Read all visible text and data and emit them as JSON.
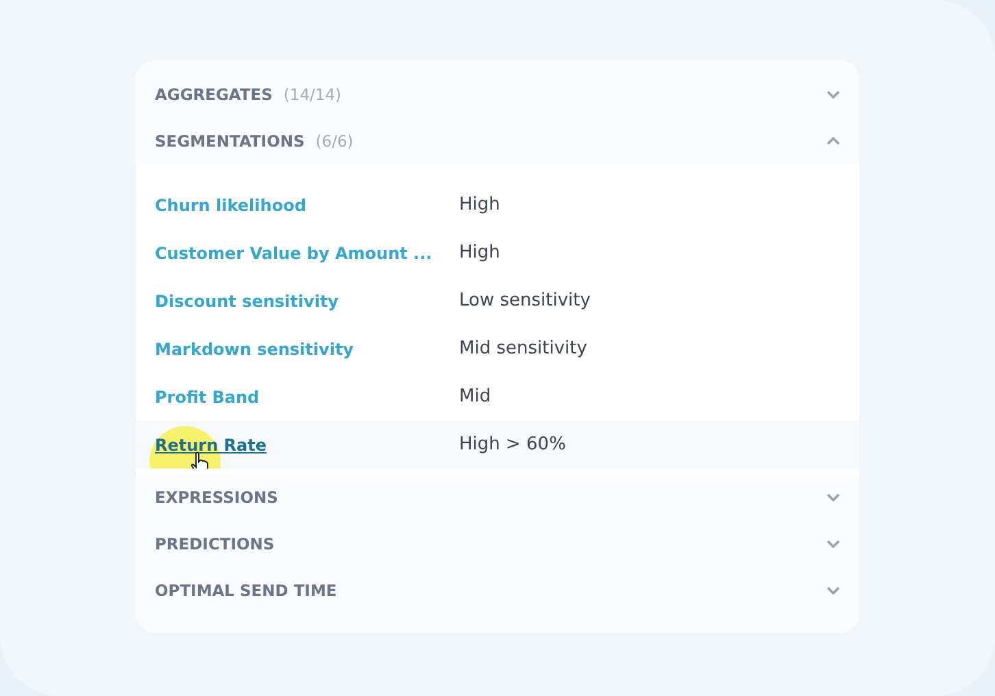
{
  "sections": [
    {
      "title": "AGGREGATES",
      "count": "(14/14)",
      "expanded": false
    },
    {
      "title": "SEGMENTATIONS",
      "count": "(6/6)",
      "expanded": true,
      "rows": [
        {
          "label": "Churn likelihood",
          "value": "High",
          "hovered": false
        },
        {
          "label": "Customer Value by Amount ...",
          "value": "High",
          "hovered": false
        },
        {
          "label": "Discount sensitivity",
          "value": "Low sensitivity",
          "hovered": false
        },
        {
          "label": "Markdown sensitivity",
          "value": "Mid sensitivity",
          "hovered": false
        },
        {
          "label": "Profit Band",
          "value": "Mid",
          "hovered": false
        },
        {
          "label": "Return Rate",
          "value": "High > 60%",
          "hovered": true
        }
      ]
    },
    {
      "title": "EXPRESSIONS",
      "expanded": false
    },
    {
      "title": "PREDICTIONS",
      "expanded": false
    },
    {
      "title": "OPTIMAL SEND TIME",
      "expanded": false
    }
  ]
}
